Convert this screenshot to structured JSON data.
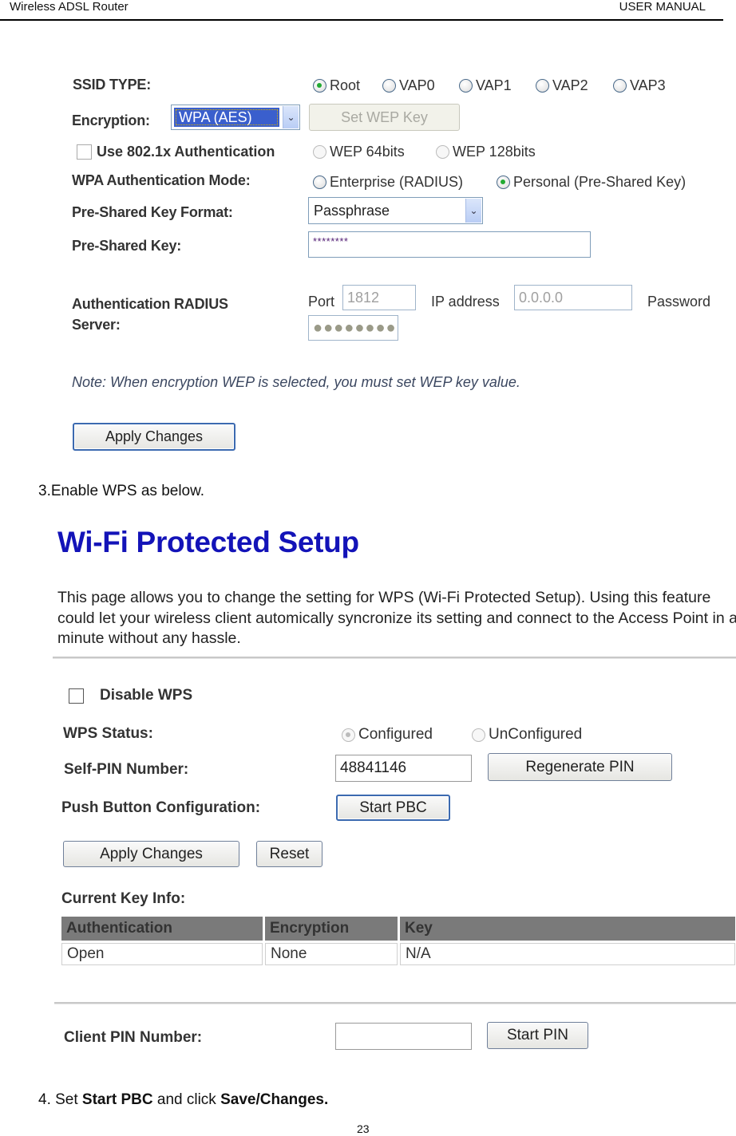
{
  "page_header": {
    "left": "Wireless ADSL Router",
    "right": "USER MANUAL"
  },
  "security": {
    "ssid_type": {
      "label": "SSID TYPE:",
      "options": [
        {
          "label": "Root",
          "selected": true
        },
        {
          "label": "VAP0",
          "selected": false
        },
        {
          "label": "VAP1",
          "selected": false
        },
        {
          "label": "VAP2",
          "selected": false
        },
        {
          "label": "VAP3",
          "selected": false
        }
      ]
    },
    "encryption": {
      "label": "Encryption:",
      "value": "WPA (AES)",
      "set_wep_key_label": "Set WEP Key"
    },
    "use_8021x": {
      "label": "Use 802.1x Authentication",
      "checked": false,
      "options": [
        {
          "label": "WEP 64bits",
          "selected": false
        },
        {
          "label": "WEP 128bits",
          "selected": false
        }
      ]
    },
    "wpa_auth_mode": {
      "label": "WPA Authentication Mode:",
      "options": [
        {
          "label": "Enterprise (RADIUS)",
          "selected": false
        },
        {
          "label": "Personal (Pre-Shared Key)",
          "selected": true
        }
      ]
    },
    "psk_format": {
      "label": "Pre-Shared Key Format:",
      "value": "Passphrase"
    },
    "psk": {
      "label": "Pre-Shared Key:",
      "value": "********"
    },
    "radius": {
      "label_line1": "Authentication RADIUS",
      "label_line2": "Server:",
      "port_label": "Port",
      "port_value": "1812",
      "ip_label": "IP address",
      "ip_value": "0.0.0.0",
      "password_label": "Password",
      "password_value": "●●●●●●●●"
    },
    "note": "Note: When encryption WEP is selected, you must set WEP key value.",
    "apply_label": "Apply Changes"
  },
  "step3": "3.Enable WPS as below.",
  "wps": {
    "title": "Wi-Fi Protected Setup",
    "description": "This page allows you to change the setting for WPS (Wi-Fi Protected Setup). Using this feature could let your wireless client automically syncronize its setting and connect to the Access Point in a minute without any hassle.",
    "disable_wps": {
      "label": "Disable WPS",
      "checked": false
    },
    "status": {
      "label": "WPS Status:",
      "options": [
        {
          "label": "Configured",
          "selected": true
        },
        {
          "label": "UnConfigured",
          "selected": false
        }
      ]
    },
    "self_pin": {
      "label": "Self-PIN Number:",
      "value": "48841146",
      "regenerate_label": "Regenerate PIN"
    },
    "pbc": {
      "label": "Push Button Configuration:",
      "button_label": "Start PBC"
    },
    "apply_label": "Apply Changes",
    "reset_label": "Reset",
    "current_key_info": {
      "label": "Current Key Info:",
      "columns": [
        "Authentication",
        "Encryption",
        "Key"
      ],
      "rows": [
        [
          "Open",
          "None",
          "N/A"
        ]
      ]
    },
    "client_pin": {
      "label": "Client PIN Number:",
      "value": "",
      "button_label": "Start PIN"
    }
  },
  "step4": {
    "prefix": "4. Set ",
    "bold1": "Start PBC",
    "middle": " and click ",
    "bold2": "Save/Changes."
  },
  "page_number": "23"
}
